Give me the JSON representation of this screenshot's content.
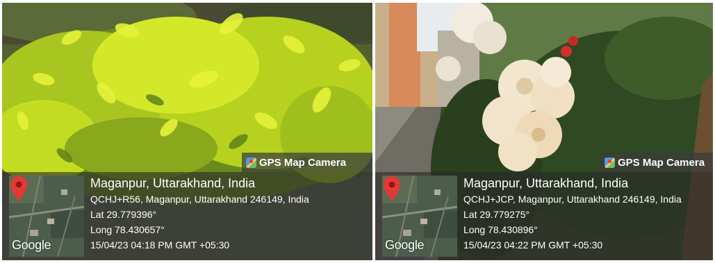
{
  "photos": [
    {
      "badge": "GPS Map Camera",
      "place": "Maganpur, Uttarakhand, India",
      "address": "QCHJ+R56, Maganpur, Uttarakhand 246149, India",
      "lat": "Lat 29.779396°",
      "long": "Long 78.430657°",
      "datetime": "15/04/23 04:18 PM GMT +05:30",
      "map_logo": "Google",
      "icons": [
        "gps-map-camera-icon",
        "map-pin-icon"
      ]
    },
    {
      "badge": "GPS Map Camera",
      "place": "Maganpur, Uttarakhand, India",
      "address": "QCHJ+JCP, Maganpur, Uttarakhand 246149, India",
      "lat": "Lat 29.779275°",
      "long": "Long 78.430896°",
      "datetime": "15/04/23 04:22 PM GMT +05:30",
      "map_logo": "Google",
      "icons": [
        "gps-map-camera-icon",
        "map-pin-icon"
      ]
    }
  ],
  "colors": {
    "foliage_yellow": "#c9e324",
    "foliage_green": "#5e8a1f",
    "rose_cream": "#f3e6cf",
    "pin_red": "#e53935",
    "overlay": "#282828"
  }
}
